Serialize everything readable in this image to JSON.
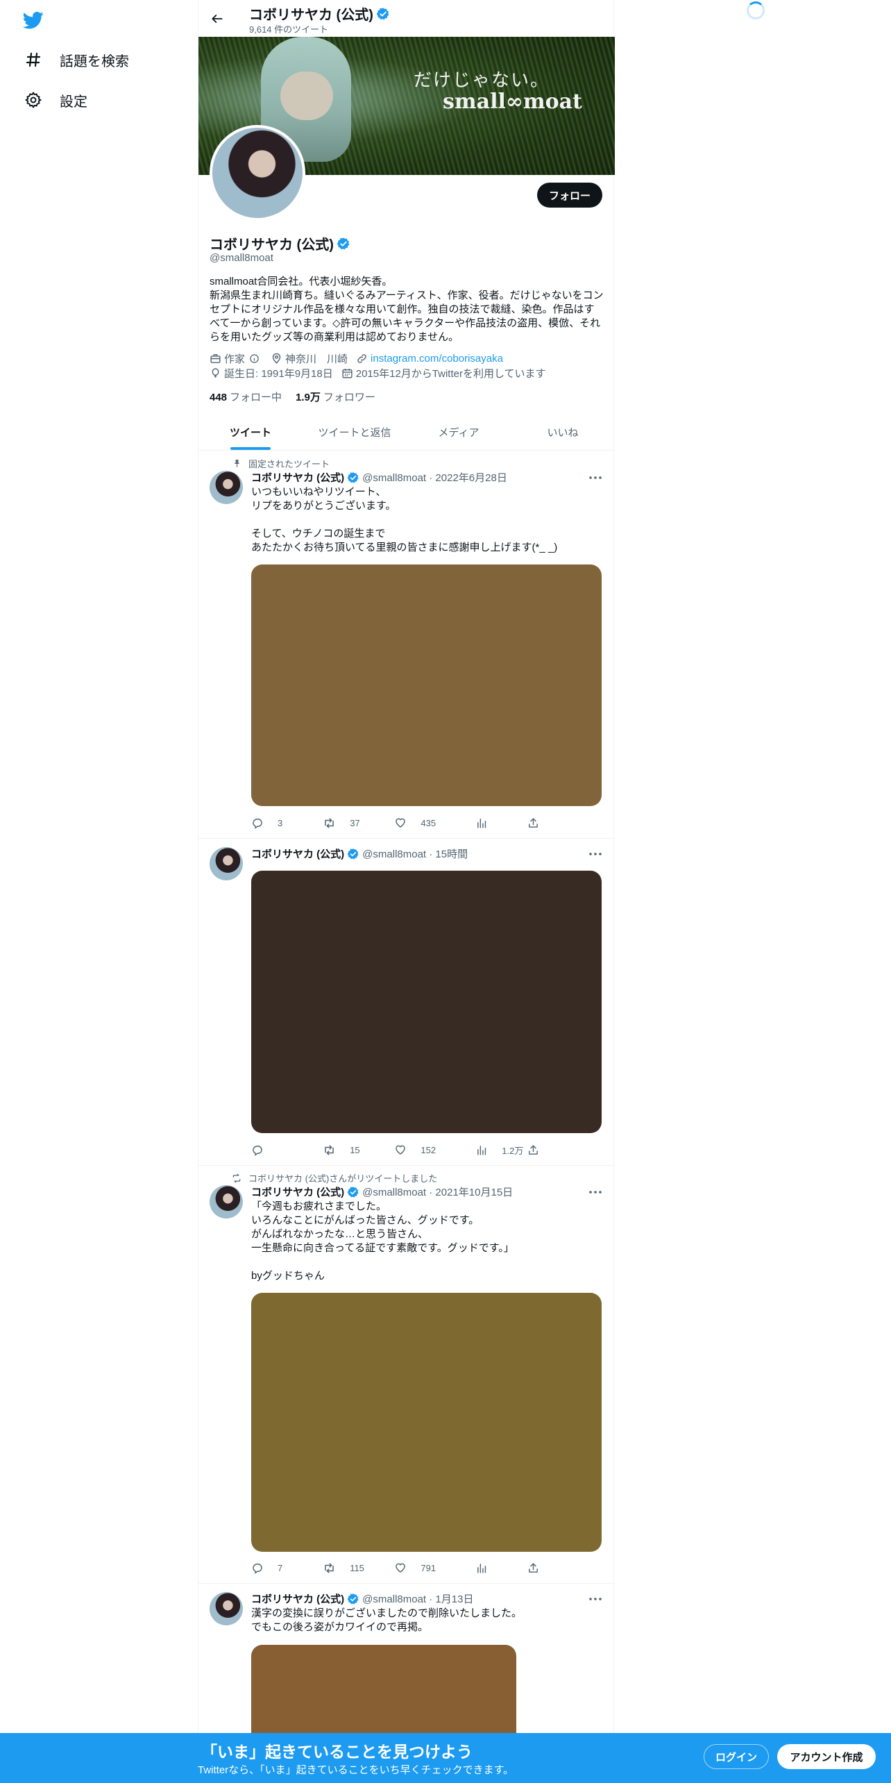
{
  "nav": {
    "explore_label": "話題を検索",
    "settings_label": "設定"
  },
  "topbar": {
    "title": "コボリサヤカ (公式)",
    "tweet_count": "9,614 件のツイート"
  },
  "banner": {
    "line1": "だけじゃない。",
    "line2": "small∞moat"
  },
  "profile": {
    "name": "コボリサヤカ (公式)",
    "handle": "@small8moat",
    "follow_label": "フォロー",
    "bio": "smallmoat合同会社。代表小堀紗矢香。\n新潟県生まれ川崎育ち。縫いぐるみアーティスト、作家、役者。だけじゃないをコンセプトにオリジナル作品を様々な用いて創作。独自の技法で裁縫、染色。作品はすべて一から創っています。◇許可の無いキャラクターや作品技法の盗用、模倣、それらを用いたグッズ等の商業利用は認めておりません。",
    "category": "作家",
    "location": "神奈川　川崎",
    "website": "instagram.com/coborisayaka",
    "birthday": "誕生日: 1991年9月18日",
    "joined": "2015年12月からTwitterを利用しています",
    "following_count": "448",
    "following_label": "フォロー中",
    "followers_count": "1.9万",
    "followers_label": "フォロワー"
  },
  "tabs": [
    {
      "label": "ツイート"
    },
    {
      "label": "ツイートと返信"
    },
    {
      "label": "メディア"
    },
    {
      "label": "いいね"
    }
  ],
  "tweets": [
    {
      "social": "固定されたツイート",
      "name": "コボリサヤカ (公式)",
      "handle_time": "@small8moat · 2022年6月28日",
      "text": "いつもいいねやリツイート、\nリプをありがとうございます。\n\nそして、ウチノコの誕生まで\nあたたかくお待ち頂いてる里親の皆さまに感謝申し上げます(*_ _)",
      "media_color": "#81643a",
      "replies": "3",
      "retweets": "37",
      "likes": "435",
      "views": ""
    },
    {
      "social": "",
      "name": "コボリサヤカ (公式)",
      "handle_time": "@small8moat · 15時間",
      "text": "",
      "media_color": "#382b24",
      "replies": "",
      "retweets": "15",
      "likes": "152",
      "views": "1.2万"
    },
    {
      "social": "コボリサヤカ (公式)さんがリツイートしました",
      "name": "コボリサヤカ (公式)",
      "handle_time": "@small8moat · 2021年10月15日",
      "text": "「今週もお疲れさまでした。\nいろんなことにがんばった皆さん、グッドです。\nがんばれなかったな…と思う皆さん、\n一生懸命に向き合ってる証です素敵です。グッドです。」\n\nbyグッドちゃん",
      "media_color": "#7e6a30",
      "replies": "7",
      "retweets": "115",
      "likes": "791",
      "views": ""
    },
    {
      "social": "",
      "name": "コボリサヤカ (公式)",
      "handle_time": "@small8moat · 1月13日",
      "text": "漢字の変換に誤りがございましたので削除いたしました。\nでもこの後ろ姿がカワイイので再掲。",
      "media_color": "#875f33",
      "replies": "",
      "retweets": "",
      "likes": "",
      "views": ""
    }
  ],
  "bottom": {
    "title": "「いま」起きていることを見つけよう",
    "subtitle": "Twitterなら、「いま」起きていることをいち早くチェックできます。",
    "login_label": "ログイン",
    "signup_label": "アカウント作成"
  },
  "colors": {
    "accent": "#1d9bf0",
    "text": "#0f1419",
    "secondary": "#536471"
  },
  "icons": [
    "twitter-logo-icon",
    "hashtag-icon",
    "gear-icon",
    "back-arrow-icon",
    "verified-badge-icon",
    "briefcase-icon",
    "info-icon",
    "location-icon",
    "link-icon",
    "balloon-icon",
    "calendar-icon",
    "pin-icon",
    "retweet-icon",
    "reply-icon",
    "like-icon",
    "views-icon",
    "share-icon",
    "more-icon"
  ]
}
